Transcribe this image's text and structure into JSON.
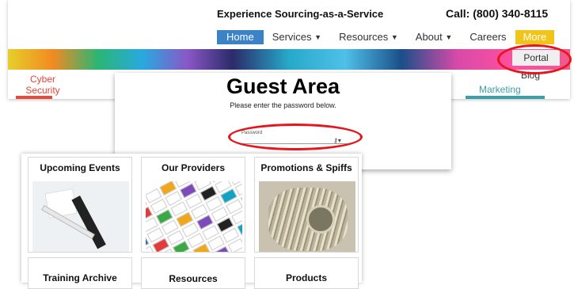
{
  "header": {
    "tagline": "Experience Sourcing-as-a-Service",
    "phone": "Call: (800) 340-8115"
  },
  "nav": {
    "items": [
      {
        "label": "Home",
        "active": true,
        "dropdown": false
      },
      {
        "label": "Services",
        "active": false,
        "dropdown": true
      },
      {
        "label": "Resources",
        "active": false,
        "dropdown": true
      },
      {
        "label": "About",
        "active": false,
        "dropdown": true
      },
      {
        "label": "Careers",
        "active": false,
        "dropdown": false
      },
      {
        "label": "More",
        "active": false,
        "dropdown": false
      }
    ],
    "more_submenu": [
      "Portal",
      "Blog"
    ]
  },
  "banner_links": {
    "cyber": "Cyber Security",
    "marketing": "Marketing"
  },
  "guest": {
    "title": "Guest Area",
    "subtitle": "Please enter the password below.",
    "password_label": "Password",
    "password_value": ""
  },
  "grid": {
    "cards": [
      {
        "title": "Upcoming Events"
      },
      {
        "title": "Our Providers"
      },
      {
        "title": "Promotions & Spiffs"
      },
      {
        "title": "Training Archive"
      },
      {
        "title": "Resources"
      },
      {
        "title": "Products"
      }
    ]
  },
  "colors": {
    "nav_active": "#3b82c7",
    "nav_more": "#f0c419",
    "annotation": "#e8141c"
  },
  "icons": {
    "dropdown": "chevron-down-icon",
    "password_toggle": "key-icon"
  }
}
